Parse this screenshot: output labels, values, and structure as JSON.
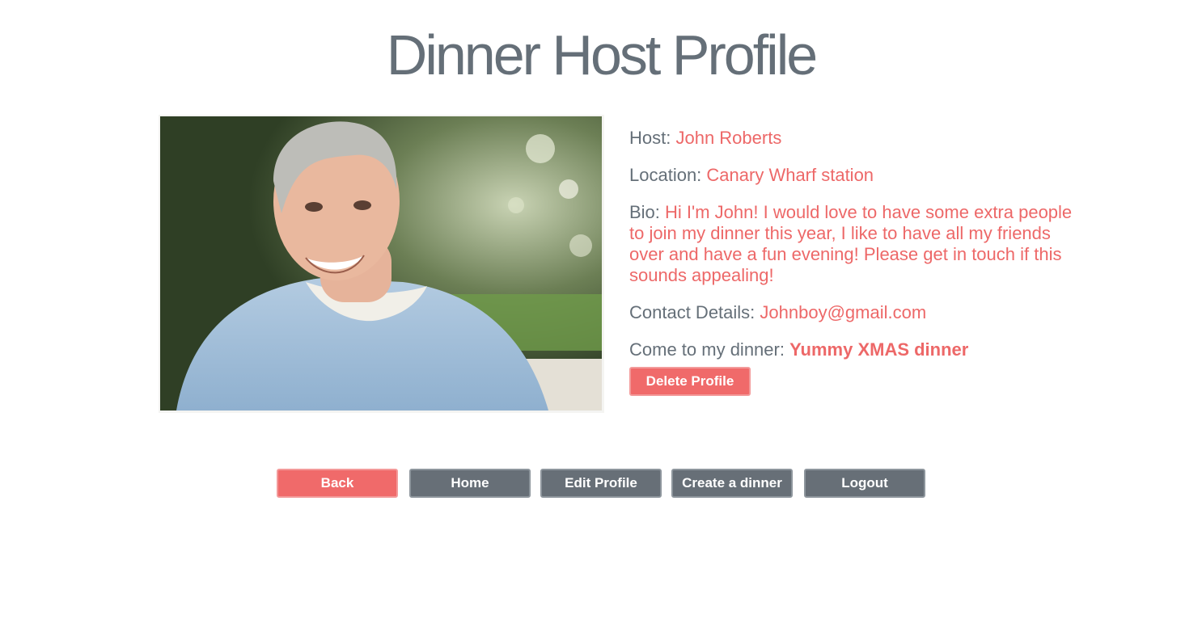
{
  "page": {
    "title": "Dinner Host Profile"
  },
  "photo": {
    "alt": "Host profile photo"
  },
  "profile": {
    "host_label": "Host: ",
    "host_value": "John Roberts",
    "location_label": "Location: ",
    "location_value": "Canary Wharf station",
    "bio_label": "Bio: ",
    "bio_value": "Hi I'm John! I would love to have some extra people to join my dinner this year, I like to have all my friends over and have a fun evening! Please get in touch if this sounds appealing!",
    "contact_label": "Contact Details: ",
    "contact_value": "Johnboy@gmail.com",
    "dinner_label": "Come to my dinner: ",
    "dinner_value": "Yummy XMAS dinner",
    "delete_label": "Delete Profile"
  },
  "nav": {
    "back_label": "Back",
    "home_label": "Home",
    "edit_label": "Edit Profile",
    "create_label": "Create a dinner",
    "logout_label": "Logout"
  },
  "colors": {
    "accent": "#f06a6a",
    "text": "#656f78",
    "button_grey": "#676f77"
  }
}
